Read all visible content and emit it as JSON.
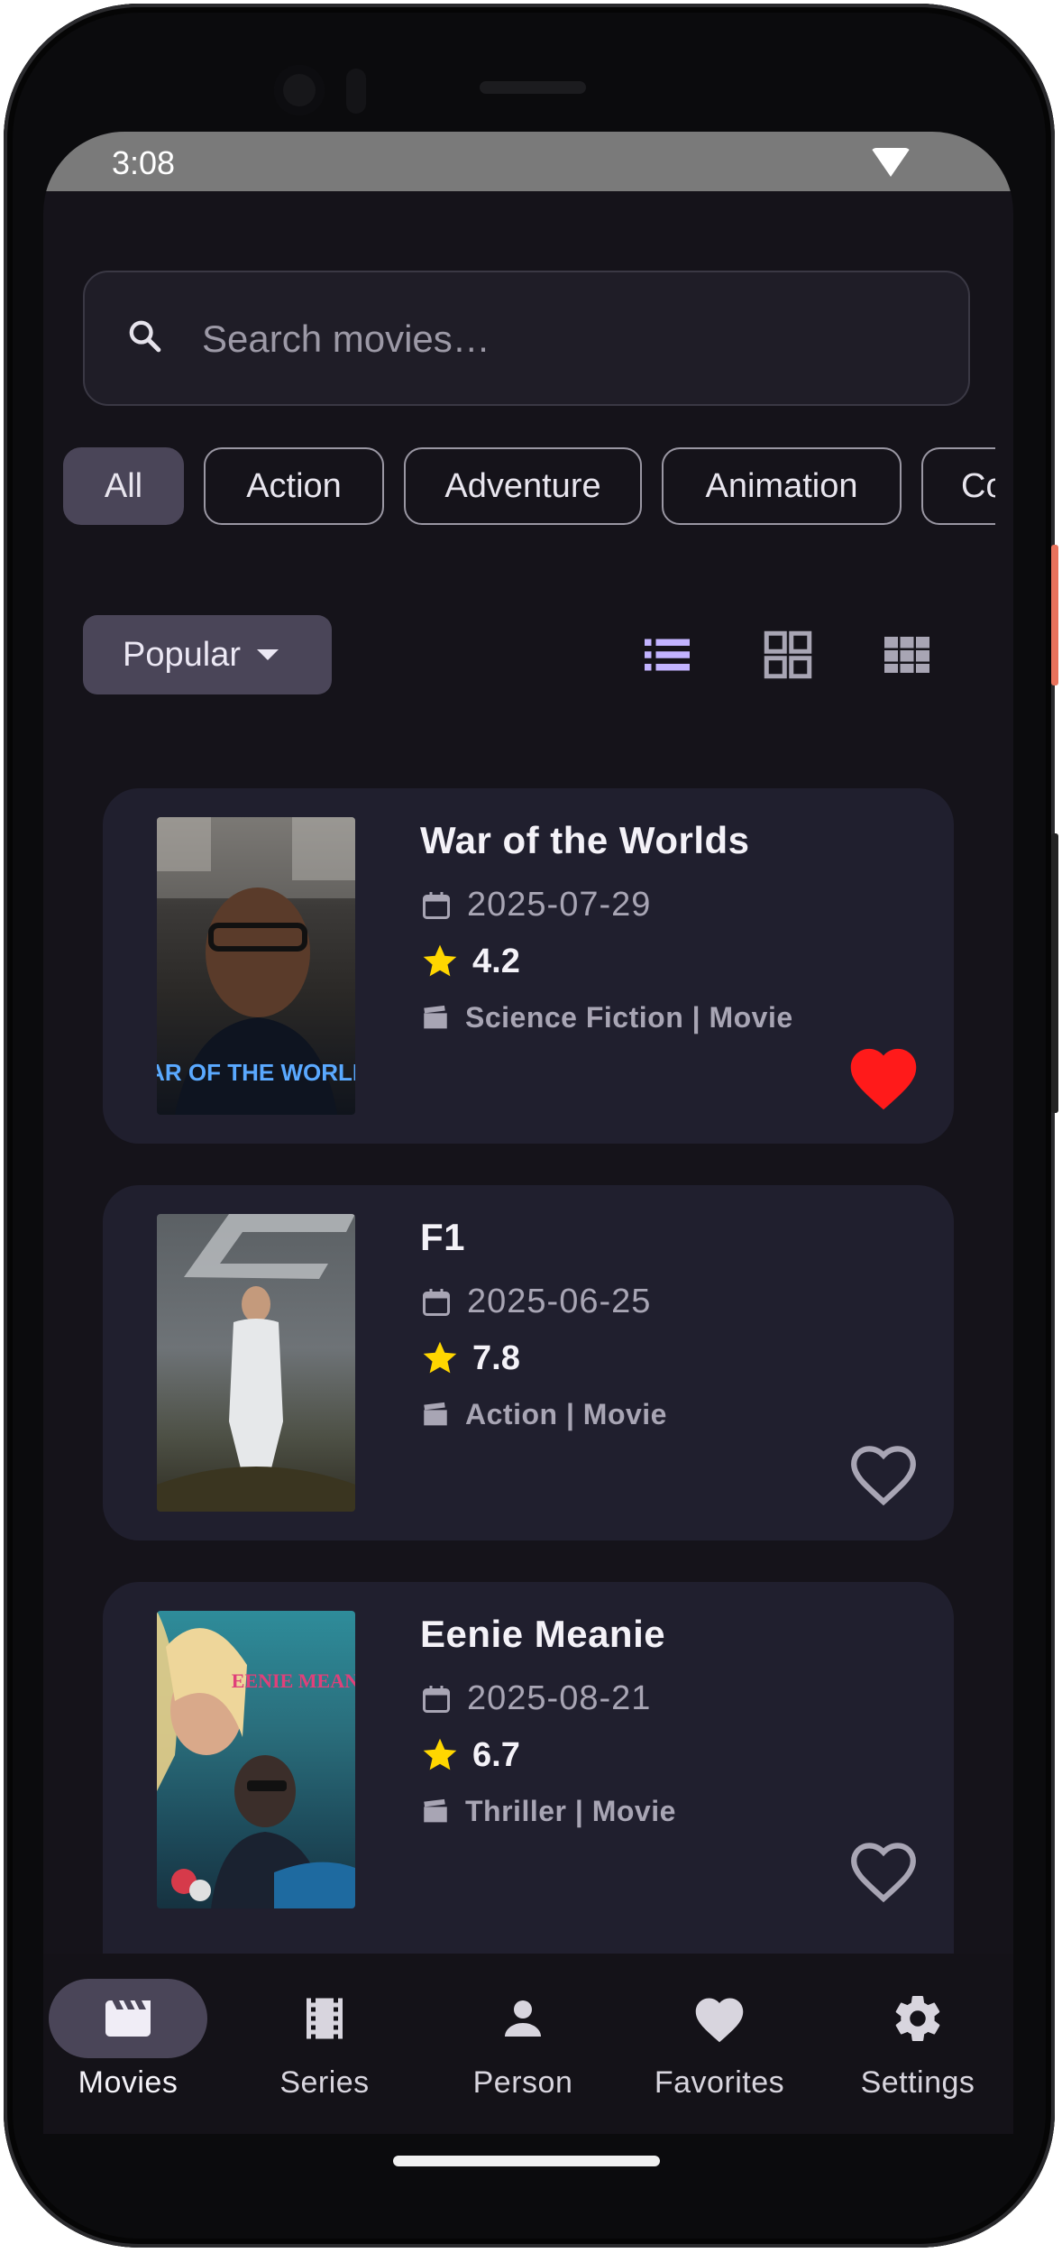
{
  "status": {
    "time": "3:08"
  },
  "search": {
    "placeholder": "Search movies…"
  },
  "genres": [
    {
      "label": "All",
      "selected": true
    },
    {
      "label": "Action",
      "selected": false
    },
    {
      "label": "Adventure",
      "selected": false
    },
    {
      "label": "Animation",
      "selected": false
    },
    {
      "label": "Co",
      "selected": false
    }
  ],
  "sort": {
    "label": "Popular"
  },
  "view_modes": {
    "active": "list-icon",
    "options": [
      "list-icon",
      "grid-icon",
      "compact-grid-icon"
    ]
  },
  "movies": [
    {
      "title": "War of the Worlds",
      "date": "2025-07-29",
      "rating": "4.2",
      "genre": "Science Fiction | Movie",
      "favorite": true,
      "poster_text": "WAR OF THE WORLDS"
    },
    {
      "title": "F1",
      "date": "2025-06-25",
      "rating": "7.8",
      "genre": "Action | Movie",
      "favorite": false
    },
    {
      "title": "Eenie Meanie",
      "date": "2025-08-21",
      "rating": "6.7",
      "genre": "Thriller | Movie",
      "favorite": false,
      "poster_text": "EENIE MEANIE"
    }
  ],
  "nav": [
    {
      "label": "Movies",
      "icon": "movie-clapper-icon",
      "active": true
    },
    {
      "label": "Series",
      "icon": "film-strip-icon",
      "active": false
    },
    {
      "label": "Person",
      "icon": "person-icon",
      "active": false
    },
    {
      "label": "Favorites",
      "icon": "heart-icon",
      "active": false
    },
    {
      "label": "Settings",
      "icon": "gear-icon",
      "active": false
    }
  ],
  "colors": {
    "accent": "#c2b3ff",
    "favorite": "#ff1a1a",
    "star": "#ffd600",
    "card": "#201f2e",
    "background": "#15131a"
  }
}
